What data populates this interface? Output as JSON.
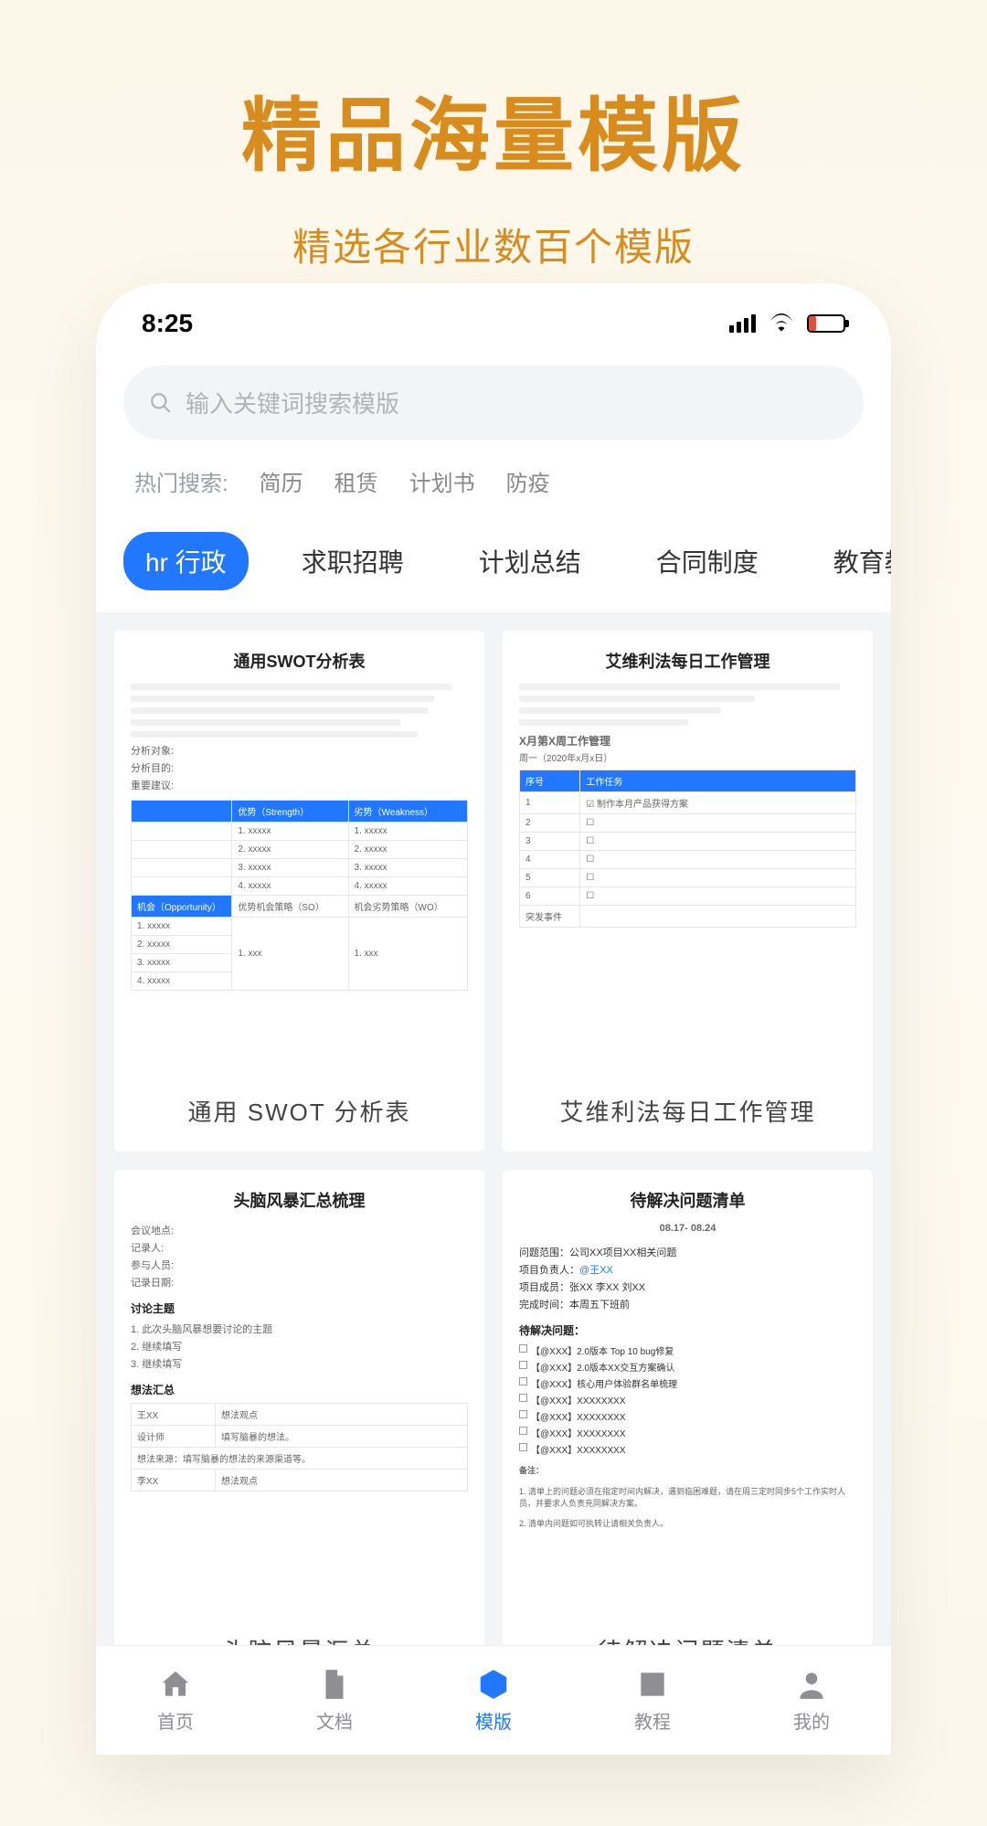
{
  "promo": {
    "title": "精品海量模版",
    "subtitle": "精选各行业数百个模版"
  },
  "status": {
    "time": "8:25"
  },
  "search": {
    "placeholder": "输入关键词搜索模版"
  },
  "hot": {
    "label": "热门搜索:",
    "tags": [
      "简历",
      "租赁",
      "计划书",
      "防疫"
    ]
  },
  "tabs": [
    "hr 行政",
    "求职招聘",
    "计划总结",
    "合同制度",
    "教育教"
  ],
  "cards": {
    "swot": {
      "inner_title": "通用SWOT分析表",
      "caption": "通用 SWOT 分析表",
      "labels": [
        "分析对象:",
        "分析目的:",
        "重要建议:"
      ],
      "head1": "优势（Strength）",
      "head2": "劣势（Weakness）",
      "rows": [
        "1.  xxxxx",
        "2.  xxxxx",
        "3.  xxxxx",
        "4.  xxxxx"
      ],
      "op_head": "机会（Opportunity）",
      "so": "优势机会策略（SO）",
      "wo": "机会劣势策略（WO）",
      "op_rows": [
        "1.  xxxxx",
        "2.  xxxxx",
        "3.  xxxxx",
        "4.  xxxxx"
      ],
      "op_cell": "1.  xxx"
    },
    "ivy": {
      "inner_title": "艾维利法每日工作管理",
      "caption": "艾维利法每日工作管理",
      "section": "X月第X周工作管理",
      "date": "周一（2020年x月x日）",
      "col1": "序号",
      "col2": "工作任务",
      "rows": [
        {
          "n": "1",
          "task": "制作本月产品获得方案",
          "checked": true
        },
        {
          "n": "2",
          "task": ""
        },
        {
          "n": "3",
          "task": ""
        },
        {
          "n": "4",
          "task": ""
        },
        {
          "n": "5",
          "task": ""
        },
        {
          "n": "6",
          "task": ""
        }
      ],
      "bottom_label": "突发事件"
    },
    "brain": {
      "inner_title": "头脑风暴汇总梳理",
      "caption": "头脑风暴汇总",
      "meta": [
        "会议地点:",
        "记录人:",
        "参与人员:",
        "记录日期:"
      ],
      "sec1": "讨论主题",
      "topics": [
        "1.  此次头脑风暴想要讨论的主题",
        "2.  继续填写",
        "3.  继续填写"
      ],
      "sec2": "想法汇总",
      "tcol1": "王XX",
      "tcol2": "想法观点",
      "trow2a": "设计师",
      "trow2b": "填写脑暴的想法。",
      "trow3": "想法来源：填写脑暴的想法的来源渠道等。",
      "trow4": "李XX",
      "trow4b": "想法观点"
    },
    "issues": {
      "inner_title": "待解决问题清单",
      "caption": "待解决问题清单",
      "daterange": "08.17- 08.24",
      "m1_label": "问题范围：",
      "m1_val": "公司XX项目XX相关问题",
      "m2_label": "项目负责人：",
      "m2_val": "@王XX",
      "m3_label": "项目成员：",
      "m3_val": "张XX  李XX  刘XX",
      "m4_label": "完成时间：",
      "m4_val": "本周五下班前",
      "sec": "待解决问题：",
      "items": [
        "【@XXX】2.0版本 Top 10 bug修复",
        "【@XXX】2.0版本XX交互方案确认",
        "【@XXX】核心用户体验群名单梳理",
        "【@XXX】XXXXXXXX",
        "【@XXX】XXXXXXXX",
        "【@XXX】XXXXXXXX",
        "【@XXX】XXXXXXXX"
      ],
      "note_head": "备注：",
      "note1": "1.  清单上的问题必须在指定时间内解决，遇到临困难题，请在周三定时同步5个工作实时人员，并要求人负责充同解决方案。",
      "note2": "2.  清单内问题如可执转让请相关负责人。"
    }
  },
  "nav": {
    "items": [
      "首页",
      "文档",
      "模版",
      "教程",
      "我的"
    ],
    "active_index": 2
  }
}
